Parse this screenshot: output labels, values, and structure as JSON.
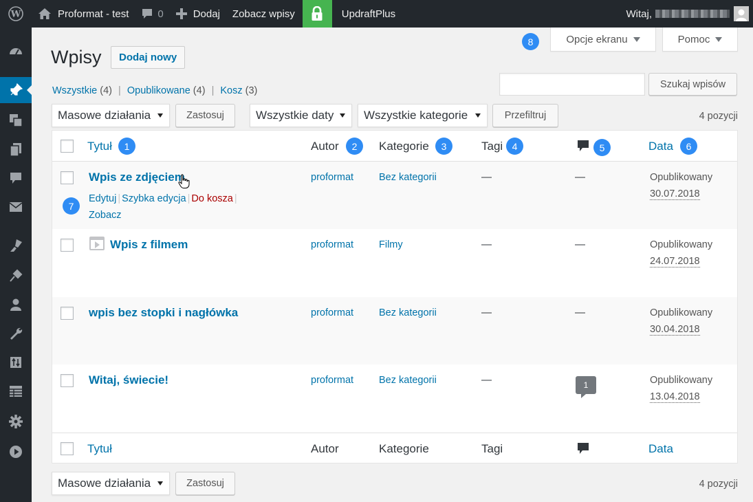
{
  "adminbar": {
    "site_name": "Proformat - test",
    "comments_count": "0",
    "add_label": "Dodaj",
    "view_posts": "Zobacz wpisy",
    "plugin": "UpdraftPlus",
    "greeting": "Witaj,"
  },
  "sidebar": {
    "icons": [
      "dashboard-icon",
      "posts-icon",
      "media-icon",
      "pages-icon",
      "comments-icon",
      "mail-icon",
      "appearance-icon",
      "plugins-icon",
      "users-icon",
      "tools-icon",
      "import-export-icon",
      "table-icon",
      "settings-icon",
      "play-icon"
    ]
  },
  "screen_options": {
    "label": "Opcje ekranu"
  },
  "help": {
    "label": "Pomoc"
  },
  "page": {
    "title": "Wpisy",
    "add_new": "Dodaj nowy"
  },
  "filters": {
    "all": "Wszystkie",
    "all_count": "(4)",
    "published": "Opublikowane",
    "published_count": "(4)",
    "trash": "Kosz",
    "trash_count": "(3)"
  },
  "search": {
    "placeholder": "",
    "button": "Szukaj wpisów"
  },
  "bulk": {
    "label": "Masowe działania",
    "apply": "Zastosuj"
  },
  "dates": {
    "label": "Wszystkie daty"
  },
  "categories_filter": {
    "label": "Wszystkie kategorie"
  },
  "filter_button": "Przefiltruj",
  "items_count": "4 pozycji",
  "columns": {
    "title": "Tytuł",
    "author": "Autor",
    "categories": "Kategorie",
    "tags": "Tagi",
    "date": "Data"
  },
  "markers": [
    "1",
    "2",
    "3",
    "4",
    "5",
    "6",
    "7",
    "8"
  ],
  "row_actions": {
    "edit": "Edytuj",
    "quick_edit": "Szybka edycja",
    "trash": "Do kosza",
    "view": "Zobacz"
  },
  "posts": [
    {
      "title": "Wpis ze zdjęciem",
      "author": "proformat",
      "category": "Bez kategorii",
      "tags": "—",
      "comments": "—",
      "status": "Opublikowany",
      "date": "30.07.2018"
    },
    {
      "title": "Wpis z filmem",
      "author": "proformat",
      "category": "Filmy",
      "tags": "—",
      "comments": "—",
      "status": "Opublikowany",
      "date": "24.07.2018"
    },
    {
      "title": "wpis bez stopki i nagłówka",
      "author": "proformat",
      "category": "Bez kategorii",
      "tags": "—",
      "comments": "—",
      "status": "Opublikowany",
      "date": "30.04.2018"
    },
    {
      "title": "Witaj, świecie!",
      "author": "proformat",
      "category": "Bez kategorii",
      "tags": "—",
      "comments": "1",
      "status": "Opublikowany",
      "date": "13.04.2018"
    }
  ],
  "colors": {
    "accent": "#0073aa",
    "adminbar": "#23282d",
    "marker": "#2f8cf4",
    "lock": "#46b450"
  }
}
